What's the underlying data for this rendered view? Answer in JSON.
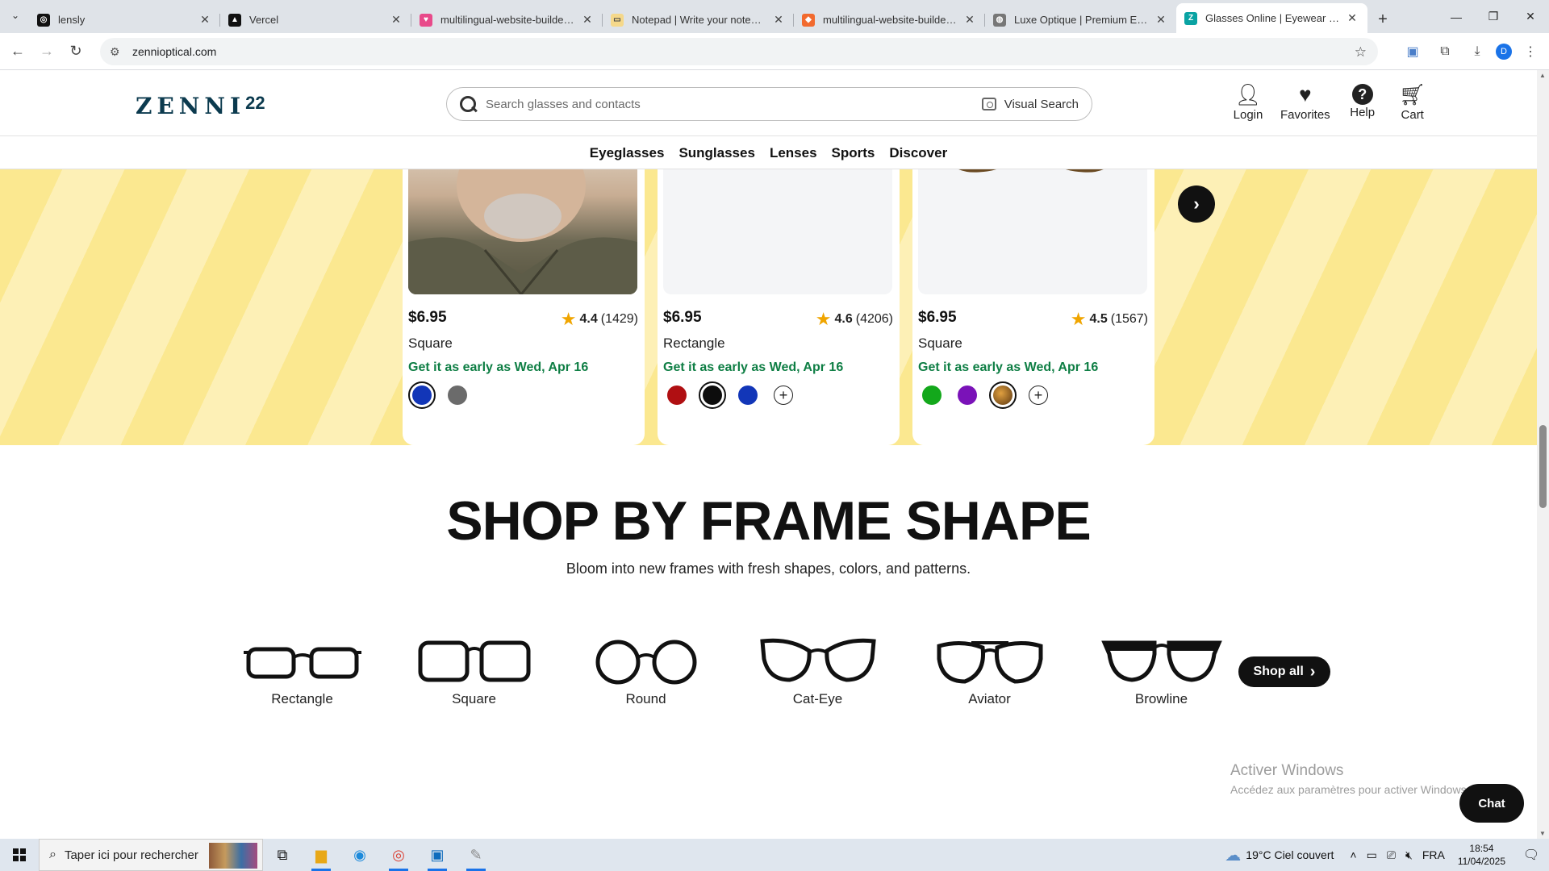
{
  "browser": {
    "tabs": [
      {
        "title": "lensly",
        "favicon_color": "#111111",
        "active": false
      },
      {
        "title": "Vercel",
        "favicon_color": "#111111",
        "active": false
      },
      {
        "title": "multilingual-website-builder - L",
        "favicon_color": "#e84a8a",
        "active": false
      },
      {
        "title": "Notepad | Write your notes onl",
        "favicon_color": "#f5d88a",
        "active": false
      },
      {
        "title": "multilingual-website-builder - F",
        "favicon_color": "#f26a2e",
        "active": false
      },
      {
        "title": "Luxe Optique | Premium Eyewe",
        "favicon_color": "#555555",
        "active": false
      },
      {
        "title": "Glasses Online | Eyewear for Ev",
        "favicon_color": "#0aa3a3",
        "active": true
      }
    ],
    "url": "zennioptical.com"
  },
  "site": {
    "logo": "ZENNI",
    "logo_badge": "22",
    "search": {
      "placeholder": "Search glasses and contacts",
      "visual_search": "Visual Search"
    },
    "header_icons": [
      {
        "label": "Login",
        "icon": "user-icon"
      },
      {
        "label": "Favorites",
        "icon": "heart-icon"
      },
      {
        "label": "Help",
        "icon": "help-icon"
      },
      {
        "label": "Cart",
        "icon": "cart-icon"
      }
    ],
    "nav": [
      "Eyeglasses",
      "Sunglasses",
      "Lenses",
      "Sports",
      "Discover"
    ]
  },
  "products": [
    {
      "price": "$6.95",
      "rating": "4.4",
      "reviews": "(1429)",
      "shape": "Square",
      "ship": "Get it as early as Wed, Apr 16",
      "swatches": [
        {
          "color": "#1236b8",
          "selected": true
        },
        {
          "color": "#6b6b6b",
          "selected": false
        }
      ],
      "more": false
    },
    {
      "price": "$6.95",
      "rating": "4.6",
      "reviews": "(4206)",
      "shape": "Rectangle",
      "ship": "Get it as early as Wed, Apr 16",
      "swatches": [
        {
          "color": "#b00f12",
          "selected": false
        },
        {
          "color": "#0d0d0d",
          "selected": true
        },
        {
          "color": "#1236b8",
          "selected": false
        }
      ],
      "more": true
    },
    {
      "price": "$6.95",
      "rating": "4.5",
      "reviews": "(1567)",
      "shape": "Square",
      "ship": "Get it as early as Wed, Apr 16",
      "swatches": [
        {
          "color": "#13a81b",
          "selected": false
        },
        {
          "color": "#7a12b8",
          "selected": false
        },
        {
          "color": "#8a5a1c",
          "selected": true
        }
      ],
      "more": true
    }
  ],
  "frame_section": {
    "title": "SHOP BY FRAME SHAPE",
    "subtitle": "Bloom into new frames with fresh shapes, colors, and patterns.",
    "shapes": [
      "Rectangle",
      "Square",
      "Round",
      "Cat-Eye",
      "Aviator",
      "Browline"
    ],
    "shop_all": "Shop all"
  },
  "overlay": {
    "activate_title": "Activer Windows",
    "activate_sub": "Accédez aux paramètres pour activer Windows.",
    "chat": "Chat"
  },
  "taskbar": {
    "search_placeholder": "Taper ici pour rechercher",
    "weather": "19°C  Ciel couvert",
    "lang": "FRA",
    "time": "18:54",
    "date": "11/04/2025"
  }
}
